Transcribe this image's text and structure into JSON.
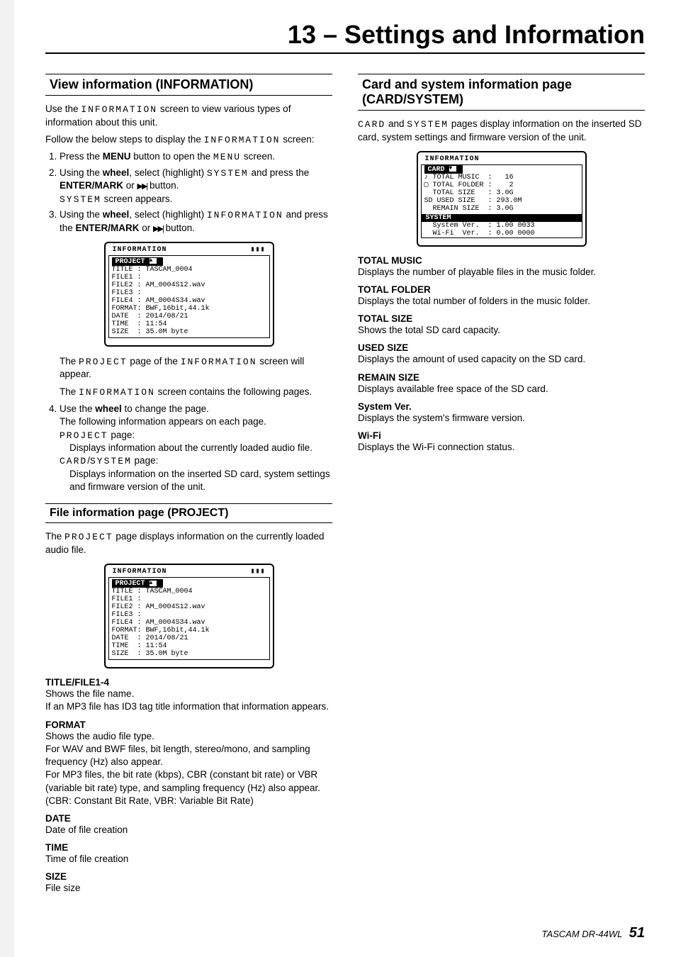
{
  "chapter": "13 – Settings and Information",
  "left": {
    "h1": "View information (INFORMATION)",
    "p1a": "Use the ",
    "p1b": "INFORMATION",
    "p1c": " screen to view various types of information about this unit.",
    "p2a": "Follow the below steps to display the ",
    "p2b": "INFORMATION",
    "p2c": " screen:",
    "s1a": "Press the ",
    "s1b": "MENU",
    "s1c": " button to open the ",
    "s1d": "MENU",
    "s1e": " screen.",
    "s2a": "Using the ",
    "s2b": "wheel",
    "s2c": ", select (highlight) ",
    "s2d": "SYSTEM",
    "s2e": " and press the ",
    "s2f": "ENTER/MARK",
    "s2g": " or ",
    "s2h": " button.",
    "s2ia": "SYSTEM",
    "s2ib": " screen appears.",
    "s3a": "Using the ",
    "s3b": "wheel",
    "s3c": ", select (highlight) ",
    "s3d": "INFORMATION",
    "s3e": " and press the ",
    "s3f": "ENTER/MARK",
    "s3g": " or ",
    "s3h": " button.",
    "pp1a": "The ",
    "pp1b": "PROJECT",
    "pp1c": " page of the ",
    "pp1d": "INFORMATION",
    "pp1e": " screen will appear.",
    "pp2a": "The ",
    "pp2b": "INFORMATION",
    "pp2c": " screen contains the following pages.",
    "s4a": "Use the ",
    "s4b": "wheel",
    "s4c": " to change the page.",
    "s4d": "The following information appears on each page.",
    "s4ea": "PROJECT",
    "s4eb": " page:",
    "s4f": "Displays information about the currently loaded audio file.",
    "s4ga": "CARD",
    "s4gb": "/",
    "s4gc": "SYSTEM",
    "s4gd": " page:",
    "s4h": "Displays information on the inserted SD card, system settings and firmware version of the unit.",
    "h2": "File information page (PROJECT)",
    "p3a": "The ",
    "p3b": "PROJECT",
    "p3c": " page displays information on the currently loaded audio file.",
    "defs": [
      {
        "t": "TITLE/FILE1-4",
        "d": "Shows the file name.\nIf an MP3 file has ID3 tag title information that information appears."
      },
      {
        "t": "FORMAT",
        "d": "Shows the audio file type.\nFor WAV and BWF files, bit length, stereo/mono, and sampling frequency (Hz) also appear.\nFor MP3 files, the bit rate (kbps), CBR (constant bit rate) or VBR (variable bit rate) type, and sampling frequency (Hz) also appear. (CBR: Constant Bit Rate, VBR: Variable Bit Rate)"
      },
      {
        "t": "DATE",
        "d": "Date of file creation"
      },
      {
        "t": "TIME",
        "d": "Time of file creation"
      },
      {
        "t": "SIZE",
        "d": "File size"
      }
    ]
  },
  "lcd1": {
    "title": "INFORMATION",
    "bat": "▮▮▮",
    "tab": "PROJECT",
    "rows": [
      "TITLE : TASCAM_0004",
      "FILE1 :",
      "FILE2 : AM_0004S12.wav",
      "FILE3 :",
      "FILE4 : AM_0004S34.wav",
      "FORMAT: BWF,16bit,44.1k",
      "DATE  : 2014/08/21",
      "TIME  : 11:54",
      "SIZE  : 35.0M byte"
    ]
  },
  "right": {
    "h1": "Card and system information page (CARD/SYSTEM)",
    "p1a": "CARD",
    "p1b": " and ",
    "p1c": "SYSTEM",
    "p1d": " pages display information on the inserted SD card, system settings and firmware version of the unit.",
    "defs": [
      {
        "t": "TOTAL MUSIC",
        "d": "Displays the number of playable files in the music folder."
      },
      {
        "t": "TOTAL FOLDER",
        "d": "Displays the total number of folders in the music folder."
      },
      {
        "t": "TOTAL SIZE",
        "d": "Shows the total SD card capacity."
      },
      {
        "t": "USED SIZE",
        "d": "Displays the amount of used capacity on the SD card."
      },
      {
        "t": "REMAIN SIZE",
        "d": "Displays available free space of the SD card."
      },
      {
        "t": "System Ver.",
        "d": "Displays the system's firmware version."
      },
      {
        "t": "Wi-Fi",
        "d": "Displays the Wi-Fi connection status."
      }
    ]
  },
  "lcd2": {
    "title": "INFORMATION",
    "tab": "CARD",
    "rows": [
      "♪ TOTAL MUSIC  :   16",
      "▢ TOTAL FOLDER :    2",
      "  TOTAL SIZE   : 3.0G",
      "SD USED SIZE   : 293.0M",
      "  REMAIN SIZE  : 3.0G"
    ],
    "sec": "SYSTEM",
    "rows2": [
      "  System Ver.  : 1.00 0033",
      "  Wi-Fi  Ver.  : 0.00 0000"
    ]
  },
  "footer": {
    "brand": "TASCAM  DR-44WL",
    "page": "51"
  }
}
